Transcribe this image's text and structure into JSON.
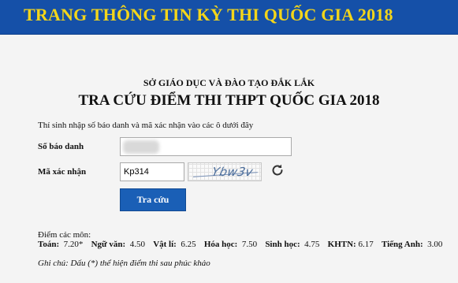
{
  "banner": {
    "title": "TRANG THÔNG TIN KỲ THI QUỐC GIA 2018"
  },
  "header": {
    "department": "SỞ GIÁO DỤC VÀ ĐÀO TẠO ĐẮK LẮK",
    "title": "TRA CỨU ĐIỂM THI THPT QUỐC GIA 2018"
  },
  "form": {
    "instruction": "Thí sinh nhập số báo danh và mã xác nhận vào các ô dưới đây",
    "sbd_label": "Số báo danh",
    "sbd_value": "",
    "captcha_label": "Mã xác nhận",
    "captcha_value": "Kp314",
    "captcha_image_text": "Ybw3v",
    "submit_label": "Tra cứu"
  },
  "results": {
    "label": "Điểm các môn:",
    "scores": [
      {
        "subject": "Toán:",
        "score": "7.20*"
      },
      {
        "subject": "Ngữ văn:",
        "score": "4.50"
      },
      {
        "subject": "Vật lí:",
        "score": "6.25"
      },
      {
        "subject": "Hóa học:",
        "score": "7.50"
      },
      {
        "subject": "Sinh học:",
        "score": "4.75"
      },
      {
        "subject": "KHTN:",
        "score": "6.17"
      },
      {
        "subject": "Tiếng Anh:",
        "score": "3.00"
      }
    ],
    "note": "Ghi chú: Dấu (*) thể hiện điểm thi sau phúc khảo"
  },
  "icons": {
    "refresh": "refresh-icon"
  },
  "colors": {
    "banner_bg": "#1550a8",
    "banner_text": "#f3d51a",
    "button_bg": "#1a5fb6"
  }
}
